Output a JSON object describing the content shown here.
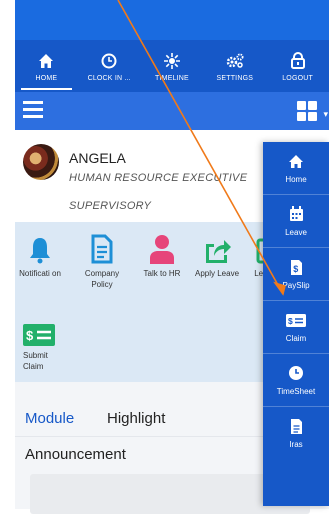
{
  "nav": {
    "items": [
      {
        "label": "HOME",
        "icon": "home-icon"
      },
      {
        "label": "CLOCK IN ...",
        "icon": "clock-icon"
      },
      {
        "label": "TIMELINE",
        "icon": "timeline-icon"
      },
      {
        "label": "SETTINGS",
        "icon": "gears-icon"
      },
      {
        "label": "LOGOUT",
        "icon": "lock-icon"
      }
    ]
  },
  "profile": {
    "name": "ANGELA",
    "role": "HUMAN RESOURCE EXECUTIVE",
    "department": "SUPERVISORY"
  },
  "shortcuts": [
    {
      "label": "Notificati on",
      "icon": "bell-icon",
      "color": "#1e8fd6"
    },
    {
      "label": "Company Policy",
      "icon": "document-icon",
      "color": "#1e8fd6"
    },
    {
      "label": "Talk to HR",
      "icon": "person-icon",
      "color": "#e6457a"
    },
    {
      "label": "Apply Leave",
      "icon": "share-icon",
      "color": "#22b06a"
    },
    {
      "label": "Le Cale",
      "icon": "calendar-icon",
      "color": "#22b06a"
    },
    {
      "label": "Submit Claim",
      "icon": "money-icon",
      "color": "#22b06a"
    }
  ],
  "tabs": {
    "module": "Module",
    "highlight": "Highlight",
    "announcement": "Announcement"
  },
  "side_menu": {
    "items": [
      {
        "label": "Home",
        "icon": "home-icon"
      },
      {
        "label": "Leave",
        "icon": "calendar-icon"
      },
      {
        "label": "PaySlip",
        "icon": "payslip-icon"
      },
      {
        "label": "Claim",
        "icon": "money-icon"
      },
      {
        "label": "TimeSheet",
        "icon": "clock-icon"
      },
      {
        "label": "Iras",
        "icon": "document-icon"
      }
    ]
  },
  "colors": {
    "nav_bg": "#1658c8",
    "toolbar_bg": "#2d6fe0",
    "shortcut_bg": "#dbe8f5",
    "annotation_arrow": "#f07a1a"
  }
}
